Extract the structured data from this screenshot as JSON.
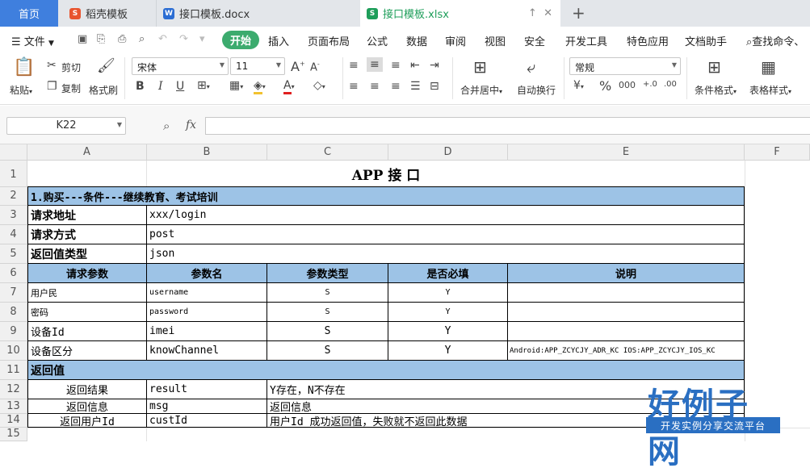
{
  "tabs": {
    "home": "首页",
    "t1": "稻壳模板",
    "t2": "接口模板.docx",
    "t3": "接口模板.xlsx"
  },
  "menu": {
    "file": "文件",
    "start": "开始",
    "insert": "插入",
    "layout": "页面布局",
    "formula": "公式",
    "data": "数据",
    "review": "审阅",
    "view": "视图",
    "security": "安全",
    "devtools": "开发工具",
    "special": "特色应用",
    "dochelper": "文档助手",
    "search": "查找命令、"
  },
  "ribbon": {
    "paste": "粘贴",
    "cut": "剪切",
    "copy": "复制",
    "format_painter": "格式刷",
    "font_name": "宋体",
    "font_size": "11",
    "merge": "合并居中",
    "wrap": "自动换行",
    "number_format": "常规",
    "cond_format": "条件格式",
    "table_style": "表格样式"
  },
  "formula_bar": {
    "name_box": "K22",
    "fx": "fx"
  },
  "columns": [
    "A",
    "B",
    "C",
    "D",
    "E",
    "F"
  ],
  "rows": [
    "1",
    "2",
    "3",
    "4",
    "5",
    "6",
    "7",
    "8",
    "9",
    "10",
    "11",
    "12",
    "13",
    "14",
    "15"
  ],
  "sheet": {
    "title": "APP 接 口",
    "section1": "1.购买---条件---继续教育、考试培训",
    "req_addr_label": "请求地址",
    "req_addr_value": "xxx/login",
    "req_method_label": "请求方式",
    "req_method_value": "post",
    "ret_type_label": "返回值类型",
    "ret_type_value": "json",
    "headers": [
      "请求参数",
      "参数名",
      "参数类型",
      "是否必填",
      "说明"
    ],
    "params": [
      {
        "label": "用户民",
        "name": "username",
        "type": "S",
        "required": "Y",
        "desc": ""
      },
      {
        "label": "密码",
        "name": "password",
        "type": "S",
        "required": "Y",
        "desc": ""
      },
      {
        "label": "设备Id",
        "name": "imei",
        "type": "S",
        "required": "Y",
        "desc": ""
      },
      {
        "label": "设备区分",
        "name": "knowChannel",
        "type": "S",
        "required": "Y",
        "desc": "Android:APP_ZCYCJY_ADR_KC  IOS:APP_ZCYCJY_IOS_KC"
      }
    ],
    "return_label": "返回值",
    "returns": [
      {
        "label": "返回结果",
        "name": "result",
        "desc": "Y存在，N不存在"
      },
      {
        "label": "返回信息",
        "name": "msg",
        "desc": "返回信息"
      },
      {
        "label": "返回用户Id",
        "name": "custId",
        "desc": "用户Id  成功返回值，失败就不返回此数据"
      }
    ]
  },
  "logo": {
    "big": "好例子网",
    "small": "开发实例分享交流平台"
  },
  "colors": {
    "header_blue": "#9dc3e6",
    "home_tab": "#3f7fde",
    "start_green": "#3cab6e"
  }
}
